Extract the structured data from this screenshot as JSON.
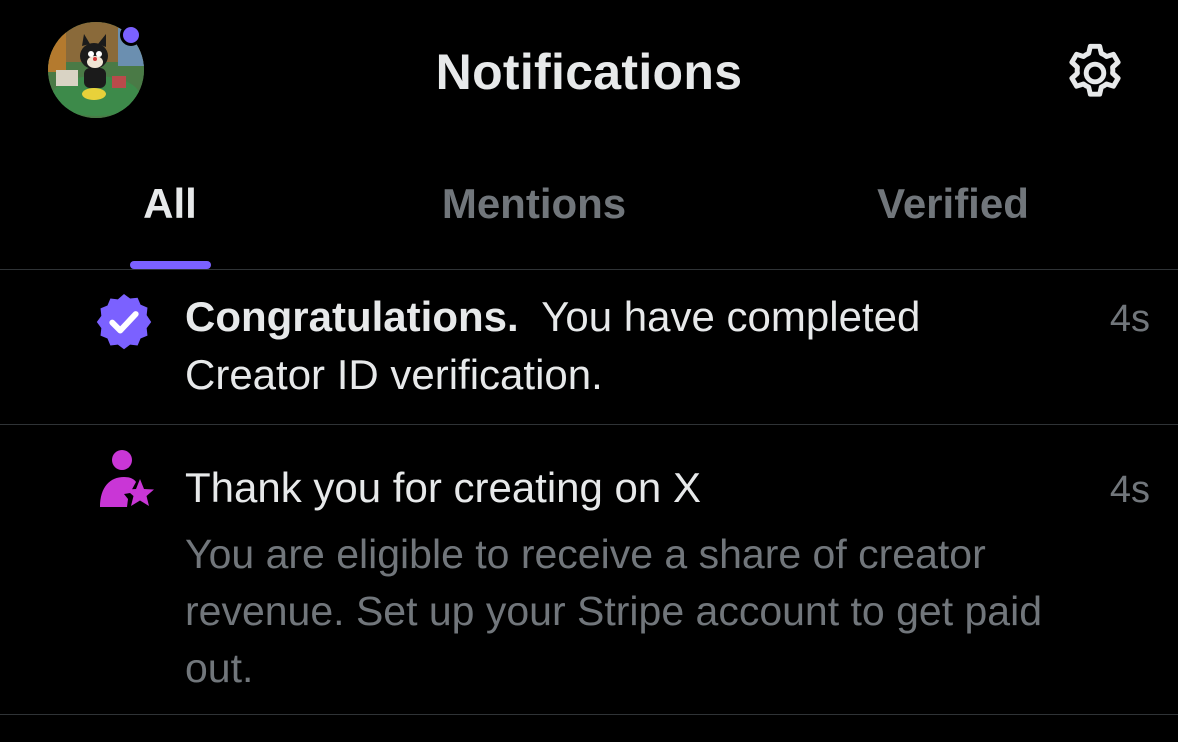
{
  "header": {
    "title": "Notifications",
    "avatar_icon": "profile-avatar-cartoon-cat",
    "settings_icon": "gear-icon"
  },
  "tabs": [
    {
      "label": "All",
      "active": true
    },
    {
      "label": "Mentions",
      "active": false
    },
    {
      "label": "Verified",
      "active": false
    }
  ],
  "notifications": [
    {
      "icon": "verified-badge-icon",
      "icon_color": "#7b61ff",
      "title": "Congratulations.",
      "text_line1": "You have completed",
      "text_line2": "Creator ID verification.",
      "time": "4s"
    },
    {
      "icon": "creator-star-person-icon",
      "icon_color": "#c936d6",
      "title": "Thank you for creating on X",
      "sub_line1": "You are eligible to receive a share of creator",
      "sub_line2": "revenue. Set up your Stripe account to get paid",
      "sub_line3": "out.",
      "time": "4s"
    }
  ],
  "colors": {
    "background": "#000000",
    "text_primary": "#e7e9ea",
    "text_secondary": "#71767b",
    "accent": "#7b61ff",
    "divider": "#2f3336"
  }
}
